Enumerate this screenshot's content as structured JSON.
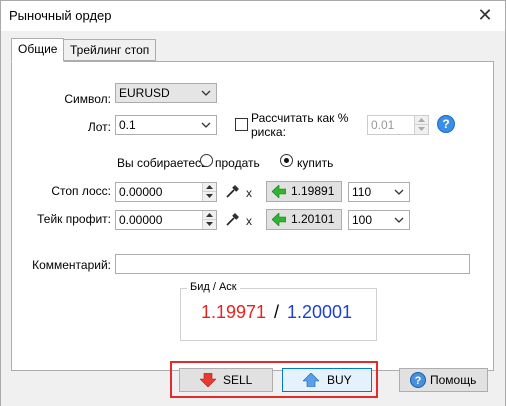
{
  "window": {
    "title": "Рыночный ордер",
    "close_glyph": "✕"
  },
  "tabs": [
    {
      "label": "Общие",
      "active": true
    },
    {
      "label": "Трейлинг стоп",
      "active": false
    }
  ],
  "form": {
    "symbol_label": "Символ:",
    "symbol_value": "EURUSD",
    "lot_label": "Лот:",
    "lot_value": "0.1",
    "risk_checkbox_label_line1": "Рассчитать как %",
    "risk_checkbox_label_line2": "риска:",
    "risk_checked": false,
    "risk_value": "0.01",
    "help_glyph": "?",
    "intent_label": "Вы собираетесь",
    "sell_radio_label": "продать",
    "buy_radio_label": "купить",
    "selected_side": "buy",
    "stop_loss_label": "Стоп лосс:",
    "stop_loss_value": "0.00000",
    "stop_loss_price": "1.19891",
    "stop_loss_points": "110",
    "take_profit_label": "Тейк профит:",
    "take_profit_value": "0.00000",
    "take_profit_price": "1.20101",
    "take_profit_points": "100",
    "x_glyph": "x",
    "comment_label": "Комментарий:",
    "comment_value": ""
  },
  "quote": {
    "legend": "Бид / Аск",
    "bid": "1.19971",
    "separator": "/",
    "ask": "1.20001",
    "bid_color": "#e8231f",
    "ask_color": "#1f3fcf"
  },
  "buttons": {
    "sell_label": "SELL",
    "buy_label": "BUY",
    "help_label": "Помощь"
  },
  "icons": {
    "close": "close-icon",
    "help": "help-icon",
    "pick": "eyedropper-icon",
    "clear": "clear-x-icon",
    "price_arrow": "green-left-arrow-icon",
    "sell": "red-down-arrow-icon",
    "buy": "blue-up-arrow-icon",
    "help_button": "question-icon"
  },
  "colors": {
    "highlight_border": "#e32b2b",
    "focus_border": "#0078d7"
  }
}
